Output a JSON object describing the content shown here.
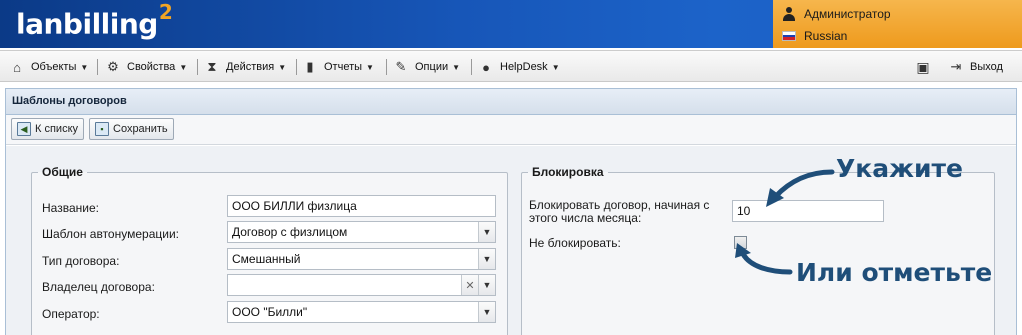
{
  "header": {
    "logo_text": "lanbilling",
    "logo_version": "2",
    "user_role": "Администратор",
    "language": "Russian"
  },
  "menu": {
    "items": [
      {
        "label": "Объекты",
        "icon": "home-icon"
      },
      {
        "label": "Свойства",
        "icon": "gear-icon"
      },
      {
        "label": "Действия",
        "icon": "hourglass-icon"
      },
      {
        "label": "Отчеты",
        "icon": "bar-chart-icon"
      },
      {
        "label": "Опции",
        "icon": "wrench-icon"
      },
      {
        "label": "HelpDesk",
        "icon": "chat-icon"
      }
    ],
    "logout_label": "Выход"
  },
  "panel": {
    "title": "Шаблоны договоров",
    "back_button": "К списку",
    "save_button": "Сохранить"
  },
  "general": {
    "legend": "Общие",
    "name_label": "Название:",
    "name_value": "ООО БИЛЛИ физлица",
    "autonum_label": "Шаблон автонумерации:",
    "autonum_value": "Договор с физлицом",
    "type_label": "Тип договора:",
    "type_value": "Смешанный",
    "owner_label": "Владелец договора:",
    "owner_value": "",
    "operator_label": "Оператор:",
    "operator_value": "ООО \"Билли\""
  },
  "blocking": {
    "legend": "Блокировка",
    "block_from_label_line1": "Блокировать договор, начиная с",
    "block_from_label_line2": "этого числа месяца:",
    "block_from_value": "10",
    "no_block_label": "Не блокировать:",
    "no_block_checked": false
  },
  "callouts": {
    "specify": "Укажите",
    "or_check": "Или отметьте",
    "color": "#1f4e79"
  }
}
